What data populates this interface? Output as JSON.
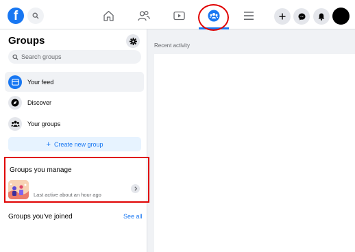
{
  "topbar": {
    "logo_letter": "f",
    "icons": {
      "search": "search-icon",
      "home": "home-icon",
      "friends": "friends-icon",
      "watch": "watch-icon",
      "groups": "groups-icon",
      "menu": "menu-icon",
      "create": "plus-icon",
      "messenger": "messenger-icon",
      "notifications": "bell-icon"
    },
    "active_tab": "groups"
  },
  "sidebar": {
    "title": "Groups",
    "search_placeholder": "Search groups",
    "items": [
      {
        "label": "Your feed",
        "icon": "feed-icon",
        "active": true
      },
      {
        "label": "Discover",
        "icon": "compass-icon",
        "active": false
      },
      {
        "label": "Your groups",
        "icon": "groups-icon",
        "active": false
      }
    ],
    "create_button": "Create new group",
    "manage": {
      "title": "Groups you manage",
      "group_meta": "Last active about an hour ago"
    },
    "joined": {
      "title": "Groups you've joined",
      "see_all": "See all"
    }
  },
  "main": {
    "recent_activity": "Recent activity"
  },
  "colors": {
    "brand": "#1877f2",
    "annotation": "#e00000",
    "background": "#f0f2f5"
  }
}
